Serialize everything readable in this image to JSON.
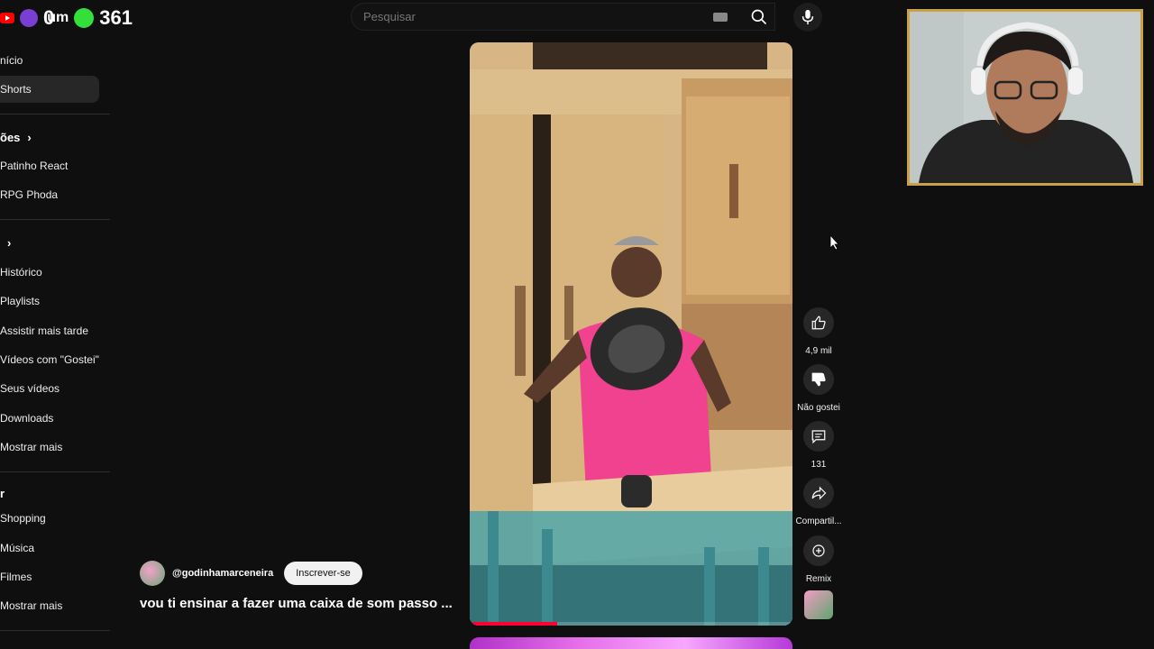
{
  "overlay": {
    "counter_left": "0",
    "counter_label": "um",
    "counter_right": "361"
  },
  "search": {
    "placeholder": "Pesquisar"
  },
  "sidebar": {
    "items": [
      {
        "label": "nício"
      },
      {
        "label": "Shorts"
      },
      {
        "label": "Patinho React"
      },
      {
        "label": "RPG Phoda"
      },
      {
        "label": "Histórico"
      },
      {
        "label": "Playlists"
      },
      {
        "label": "Assistir mais tarde"
      },
      {
        "label": "Vídeos com \"Gostei\""
      },
      {
        "label": "Seus vídeos"
      },
      {
        "label": "Downloads"
      },
      {
        "label": "Mostrar mais"
      },
      {
        "label": "Shopping"
      },
      {
        "label": "Música"
      },
      {
        "label": "Filmes"
      },
      {
        "label": "Mostrar mais"
      }
    ],
    "section_subs": "ões",
    "section_you": "",
    "section_explore": "r"
  },
  "video": {
    "progress_fraction": 0.27
  },
  "actions": {
    "like_count": "4,9 mil",
    "dislike_label": "Não gostei",
    "comments_count": "131",
    "share_label": "Compartil...",
    "remix_label": "Remix"
  },
  "channel": {
    "handle": "@godinhamarceneira",
    "subscribe_label": "Inscrever-se"
  },
  "caption": "vou ti ensinar a fazer uma caixa de som passo ..."
}
